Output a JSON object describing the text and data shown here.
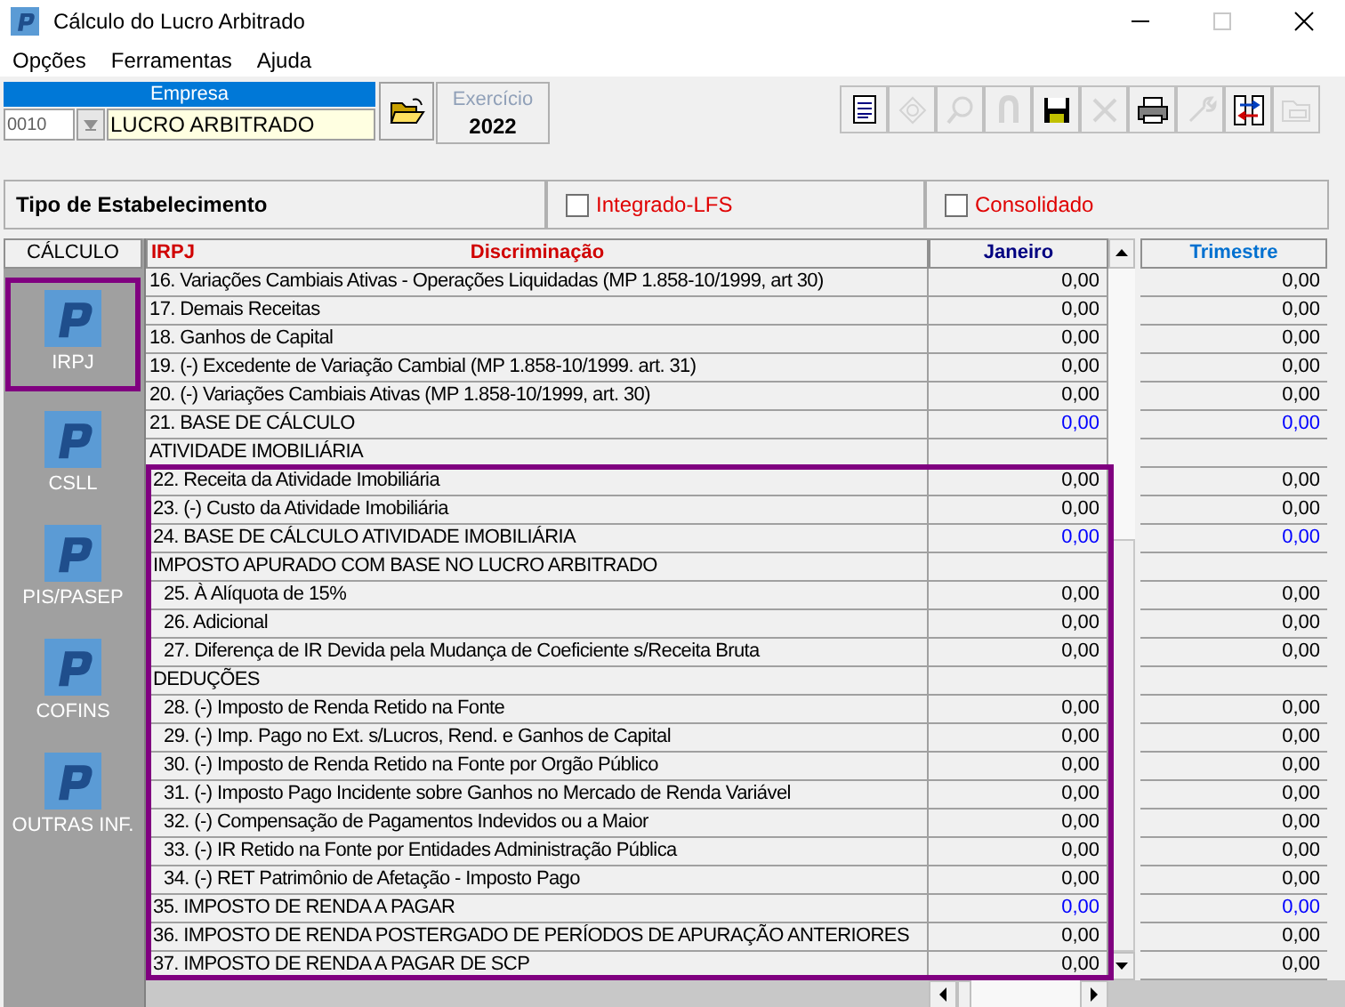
{
  "window": {
    "title": "Cálculo do Lucro Arbitrado"
  },
  "menu": [
    "Opções",
    "Ferramentas",
    "Ajuda"
  ],
  "empresa": {
    "header": "Empresa",
    "code": "0010",
    "name": "LUCRO ARBITRADO"
  },
  "exercicio": {
    "label": "Exercício",
    "value": "2022"
  },
  "toolbar": [
    {
      "kind": "document",
      "disabled": false
    },
    {
      "kind": "diamond",
      "disabled": true
    },
    {
      "kind": "search",
      "disabled": true
    },
    {
      "kind": "magnet",
      "disabled": true
    },
    {
      "kind": "save",
      "disabled": false
    },
    {
      "kind": "close",
      "disabled": true
    },
    {
      "kind": "print",
      "disabled": false
    },
    {
      "kind": "wrench",
      "disabled": true
    },
    {
      "kind": "transfer",
      "disabled": false
    },
    {
      "kind": "folder",
      "disabled": true
    }
  ],
  "tipo_estabelecimento": {
    "label": "Tipo de Estabelecimento",
    "options": [
      {
        "label": "Integrado-LFS",
        "checked": false
      },
      {
        "label": "Consolidado",
        "checked": false
      }
    ]
  },
  "sidebar": {
    "header": "CÁLCULO",
    "items": [
      {
        "label": "IRPJ",
        "selected": true
      },
      {
        "label": "CSLL",
        "selected": false
      },
      {
        "label": "PIS/PASEP",
        "selected": false
      },
      {
        "label": "COFINS",
        "selected": false
      },
      {
        "label": "OUTRAS INF.",
        "selected": false
      }
    ]
  },
  "table": {
    "title": "IRPJ",
    "columns": [
      "Discriminação",
      "Janeiro",
      "Trimestre"
    ],
    "rows": [
      {
        "label": "16. Variações Cambiais Ativas - Operações Liquidadas (MP 1.858-10/1999, art 30)",
        "kind": "item",
        "total": false,
        "highlighted": false,
        "janeiro": "0,00",
        "trimestre": "0,00"
      },
      {
        "label": "17. Demais Receitas",
        "kind": "item",
        "total": false,
        "highlighted": false,
        "janeiro": "0,00",
        "trimestre": "0,00"
      },
      {
        "label": "18. Ganhos de Capital",
        "kind": "item",
        "total": false,
        "highlighted": false,
        "janeiro": "0,00",
        "trimestre": "0,00"
      },
      {
        "label": "19. (-) Excedente de Variação Cambial (MP 1.858-10/1999. art. 31)",
        "kind": "item",
        "total": false,
        "highlighted": false,
        "janeiro": "0,00",
        "trimestre": "0,00"
      },
      {
        "label": "20. (-) Variações Cambiais Ativas (MP 1.858-10/1999, art. 30)",
        "kind": "item",
        "total": false,
        "highlighted": false,
        "janeiro": "0,00",
        "trimestre": "0,00"
      },
      {
        "label": "21. BASE DE CÁLCULO",
        "kind": "item",
        "total": true,
        "highlighted": false,
        "janeiro": "0,00",
        "trimestre": "0,00"
      },
      {
        "label": "ATIVIDADE IMOBILIÁRIA",
        "kind": "section",
        "highlighted": false
      },
      {
        "label": "22. Receita da Atividade Imobiliária",
        "kind": "item",
        "total": false,
        "highlighted": true,
        "janeiro": "0,00",
        "trimestre": "0,00"
      },
      {
        "label": "23. (-) Custo da Atividade Imobiliária",
        "kind": "item",
        "total": false,
        "highlighted": true,
        "janeiro": "0,00",
        "trimestre": "0,00"
      },
      {
        "label": "24. BASE DE CÁLCULO ATIVIDADE IMOBILIÁRIA",
        "kind": "item",
        "total": true,
        "highlighted": true,
        "janeiro": "0,00",
        "trimestre": "0,00"
      },
      {
        "label": "IMPOSTO APURADO COM BASE NO LUCRO ARBITRADO",
        "kind": "section",
        "highlighted": true
      },
      {
        "label": "25. À Alíquota de 15%",
        "kind": "sub_item",
        "total": false,
        "highlighted": true,
        "janeiro": "0,00",
        "trimestre": "0,00"
      },
      {
        "label": "26. Adicional",
        "kind": "sub_item",
        "total": false,
        "highlighted": true,
        "janeiro": "0,00",
        "trimestre": "0,00"
      },
      {
        "label": "27. Diferença de IR Devida pela Mudança de Coeficiente s/Receita Bruta",
        "kind": "sub_item",
        "total": false,
        "highlighted": true,
        "janeiro": "0,00",
        "trimestre": "0,00"
      },
      {
        "label": "DEDUÇÕES",
        "kind": "section",
        "highlighted": true
      },
      {
        "label": "28. (-) Imposto de Renda Retido na Fonte",
        "kind": "sub_item",
        "total": false,
        "highlighted": true,
        "janeiro": "0,00",
        "trimestre": "0,00"
      },
      {
        "label": "29. (-) Imp. Pago no Ext. s/Lucros, Rend. e Ganhos de Capital",
        "kind": "sub_item",
        "total": false,
        "highlighted": true,
        "janeiro": "0,00",
        "trimestre": "0,00"
      },
      {
        "label": "30. (-) Imposto de Renda Retido na Fonte por Orgão Público",
        "kind": "sub_item",
        "total": false,
        "highlighted": true,
        "janeiro": "0,00",
        "trimestre": "0,00"
      },
      {
        "label": "31. (-) Imposto Pago Incidente sobre Ganhos no Mercado de Renda Variável",
        "kind": "sub_item",
        "total": false,
        "highlighted": true,
        "janeiro": "0,00",
        "trimestre": "0,00"
      },
      {
        "label": "32. (-) Compensação de Pagamentos Indevidos ou a Maior",
        "kind": "sub_item",
        "total": false,
        "highlighted": true,
        "janeiro": "0,00",
        "trimestre": "0,00"
      },
      {
        "label": "33. (-) IR Retido na Fonte por Entidades Administração Pública",
        "kind": "sub_item",
        "total": false,
        "highlighted": true,
        "janeiro": "0,00",
        "trimestre": "0,00"
      },
      {
        "label": "34. (-) RET Patrimônio de Afetação - Imposto Pago",
        "kind": "sub_item",
        "total": false,
        "highlighted": true,
        "janeiro": "0,00",
        "trimestre": "0,00"
      },
      {
        "label": "35. IMPOSTO DE RENDA A PAGAR",
        "kind": "item",
        "total": true,
        "highlighted": true,
        "janeiro": "0,00",
        "trimestre": "0,00"
      },
      {
        "label": "36. IMPOSTO DE RENDA POSTERGADO DE PERÍODOS DE APURAÇÃO ANTERIORES",
        "kind": "item",
        "total": false,
        "highlighted": true,
        "janeiro": "0,00",
        "trimestre": "0,00"
      },
      {
        "label": "37. IMPOSTO DE RENDA A PAGAR DE SCP",
        "kind": "item",
        "total": false,
        "highlighted": true,
        "janeiro": "0,00",
        "trimestre": "0,00"
      }
    ]
  }
}
